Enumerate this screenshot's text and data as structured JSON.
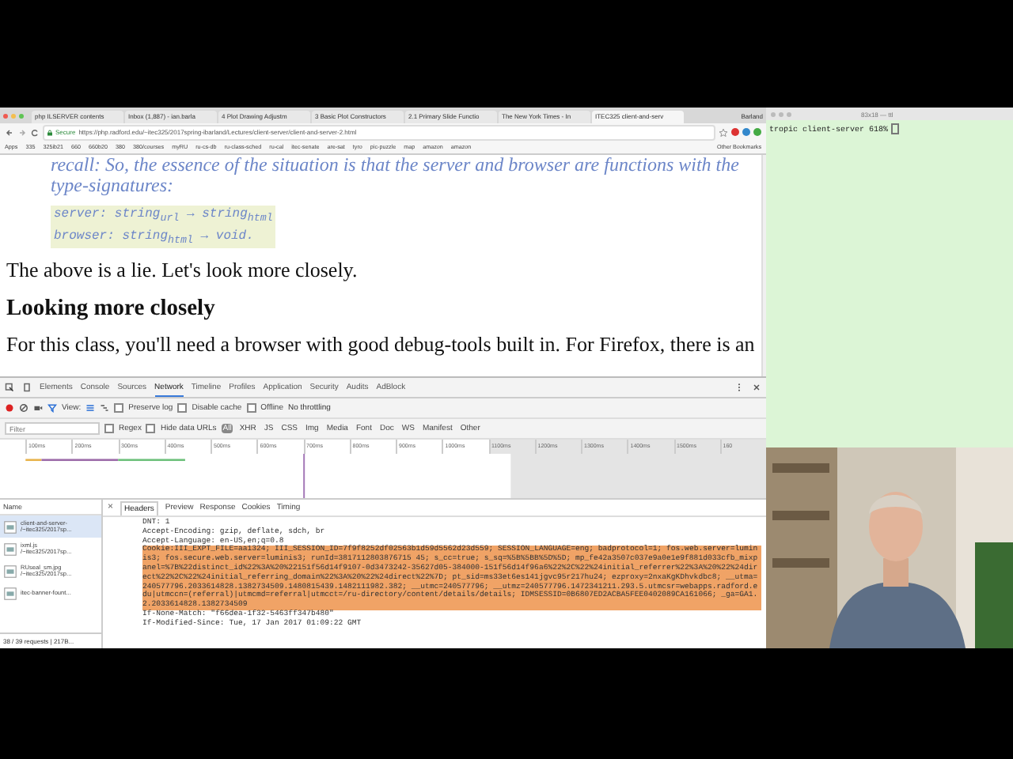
{
  "browser": {
    "tabs": [
      {
        "label": "php ILSERVER contents",
        "selected": false
      },
      {
        "label": "Inbox (1,887) - ian.barla",
        "selected": false
      },
      {
        "label": "4 Plot Drawing Adjustm",
        "selected": false
      },
      {
        "label": "3 Basic Plot Constructors",
        "selected": false
      },
      {
        "label": "2.1 Primary Slide Functio",
        "selected": false
      },
      {
        "label": "The New York Times - In",
        "selected": false
      },
      {
        "label": "ITEC325 client-and-serv",
        "selected": true
      }
    ],
    "profile": "Barland",
    "address": {
      "secure_label": "Secure",
      "url": "https://php.radford.edu/~itec325/2017spring-ibarland/Lectures/client-server/client-and-server-2.html"
    },
    "bookmarks": [
      "Apps",
      "335",
      "325ib21",
      "660",
      "660b20",
      "380",
      "380/courses",
      "myRU",
      "ru-cs-db",
      "ru-class-sched",
      "ru-cal",
      "itec-senate",
      "are-sat",
      "tyro",
      "pic-puzzle",
      "map",
      "amazon",
      "amazon"
    ],
    "other_bookmarks": "Other Bookmarks"
  },
  "page": {
    "recall": "recall: So, the essence of the situation is that the server and browser are functions with the type-signatures:",
    "signatures": [
      "server: string$_{url}$ → string$_{html}$",
      "browser: string$_{html}$ → void."
    ],
    "paragraph": "The above is a lie. Let's look more closely.",
    "heading": "Looking more closely",
    "paragraph_2": "For this class, you'll need a browser with good debug-tools built in. For Firefox, there is an"
  },
  "devtools": {
    "tabs": [
      {
        "label": "Elements",
        "selected": false
      },
      {
        "label": "Console",
        "selected": false
      },
      {
        "label": "Sources",
        "selected": false
      },
      {
        "label": "Network",
        "selected": true
      },
      {
        "label": "Timeline",
        "selected": false
      },
      {
        "label": "Profiles",
        "selected": false
      },
      {
        "label": "Application",
        "selected": false
      },
      {
        "label": "Security",
        "selected": false
      },
      {
        "label": "Audits",
        "selected": false
      },
      {
        "label": "AdBlock",
        "selected": false
      }
    ],
    "view_label": "View:",
    "options": [
      {
        "label": "Preserve log",
        "checked": false
      },
      {
        "label": "Disable cache",
        "checked": false
      },
      {
        "label": "Offline",
        "checked": false
      }
    ],
    "throttling": "No throttling",
    "filter": {
      "placeholder": "Filter"
    },
    "filter_options": [
      {
        "label": "Regex",
        "checked": false
      },
      {
        "label": "Hide data URLs",
        "checked": false
      }
    ],
    "types": [
      {
        "label": "All",
        "selected": true
      },
      {
        "label": "XHR",
        "selected": false
      },
      {
        "label": "JS",
        "selected": false
      },
      {
        "label": "CSS",
        "selected": false
      },
      {
        "label": "Img",
        "selected": false
      },
      {
        "label": "Media",
        "selected": false
      },
      {
        "label": "Font",
        "selected": false
      },
      {
        "label": "Doc",
        "selected": false
      },
      {
        "label": "WS",
        "selected": false
      },
      {
        "label": "Manifest",
        "selected": false
      },
      {
        "label": "Other",
        "selected": false
      }
    ],
    "timeline_ticks": [
      "100ms",
      "200ms",
      "300ms",
      "400ms",
      "500ms",
      "600ms",
      "700ms",
      "800ms",
      "900ms",
      "1000ms",
      "1100ms",
      "1200ms",
      "1300ms",
      "1400ms",
      "1500ms",
      "160"
    ],
    "name_column": "Name",
    "requests": [
      {
        "name": "client-and-server-",
        "path": "/~itec325/2017sp...",
        "selected": true
      },
      {
        "name": "ixml.js",
        "path": "/~itec325/2017sp...",
        "selected": false
      },
      {
        "name": "RUseal_sm.jpg",
        "path": "/~itec325/2017sp...",
        "selected": false
      },
      {
        "name": "itec-banner-fount...",
        "selected": false
      }
    ],
    "status": "38 / 39 requests | 217B...",
    "close_glyph": "×",
    "detail_tabs": [
      {
        "label": "Headers",
        "selected": true
      },
      {
        "label": "Preview",
        "selected": false
      },
      {
        "label": "Response",
        "selected": false
      },
      {
        "label": "Cookies",
        "selected": false
      },
      {
        "label": "Timing",
        "selected": false
      }
    ],
    "headers": [
      {
        "text": "DNT: 1",
        "highlighted": false
      },
      {
        "text": "Accept-Encoding: gzip, deflate, sdch, br",
        "highlighted": false
      },
      {
        "text": "Accept-Language: en-US,en;q=0.8",
        "highlighted": false
      },
      {
        "name": "Cookie:",
        "text": "III_EXPT_FILE=aa1324; III_SESSION_ID=7f9f8252df02563b1d59d5562d23d559; SESSION_LANGUAGE=eng; badprotocol=1; fos.web.server=luminis3; fos.secure.web.server=luminis3; runId=3817112803876715 45; s_cc=true; s_sq=%5B%5BB%5D%5D; mp_fe42a3507c037e9a0e1e9f881d033cfb_mixpanel=%7B%22distinct_id%22%3A%20%22151f56d14f9107-0d3473242-35627d05-384000-151f56d14f96a6%22%2C%22%24initial_referrer%22%3A%20%22%24direct%22%2C%22%24initial_referring_domain%22%3A%20%22%24direct%22%7D; pt_sid=ms33et6es141jgvc95r217hu24; ezproxy=2nxaKgKDhvkdbc8; __utma=240577796.2033614828.1382734509.1480815439.1482111982.382; __utmc=240577796; __utmz=240577796.1472341211.293.5.utmcsr=webapps.radford.edu|utmccn=(referral)|utmcmd=referral|utmcct=/ru-directory/content/details/details; IDMSESSID=0B6807ED2ACBA5FEE0402089CA161066; _ga=GA1.2.2033614828.1382734509",
        "highlighted": true
      },
      {
        "text": "If-None-Match: \"f66dea-1f32-5463ff347b480\"",
        "highlighted": false
      },
      {
        "text": "If-Modified-Since: Tue, 17 Jan 2017 01:09:22 GMT",
        "highlighted": false
      }
    ]
  },
  "terminal": {
    "title": "83x18 — ttl",
    "prompt": "tropic client-server 618%"
  }
}
